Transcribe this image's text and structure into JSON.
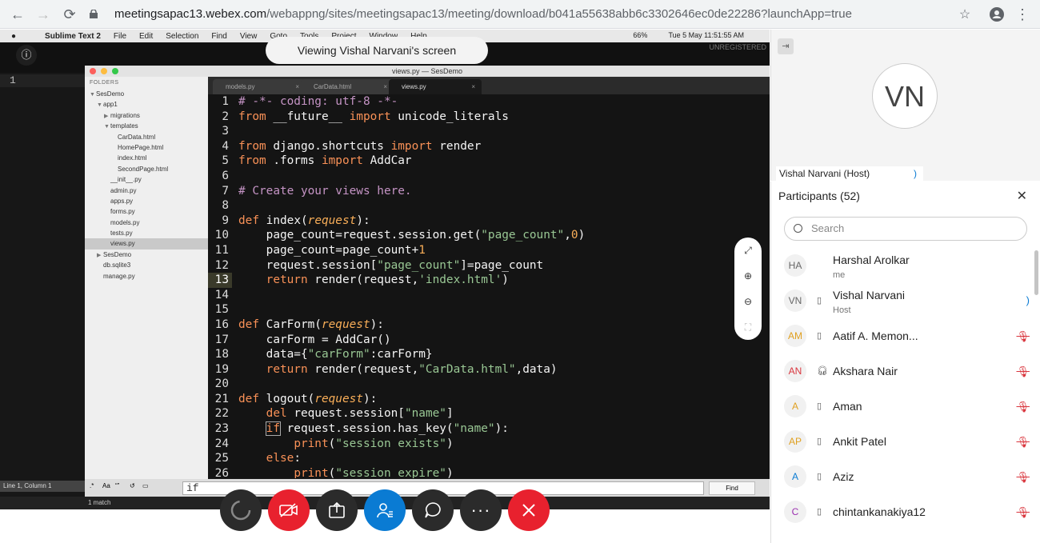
{
  "browser": {
    "url_host": "meetingsapac13.webex.com",
    "url_path": "/webappng/sites/meetingsapac13/meeting/download/b041a55638abb6c3302646ec0de22286?launchApp=true"
  },
  "mac_menubar": {
    "app": "Sublime Text 2",
    "menus": [
      "File",
      "Edit",
      "Selection",
      "Find",
      "View",
      "Goto",
      "Tools",
      "Project",
      "Window",
      "Help"
    ],
    "battery": "66%",
    "clock": "Tue 5 May  11:51:55 AM"
  },
  "viewing_banner": "Viewing Vishal Narvani's screen",
  "unregistered": "UNREGISTERED",
  "sublime": {
    "window_title": "views.py — SesDemo",
    "folders_header": "FOLDERS",
    "tree": [
      {
        "label": "SesDemo",
        "indent": 0,
        "arrow": "▼"
      },
      {
        "label": "app1",
        "indent": 1,
        "arrow": "▼"
      },
      {
        "label": "migrations",
        "indent": 2,
        "arrow": "▶"
      },
      {
        "label": "templates",
        "indent": 2,
        "arrow": "▼"
      },
      {
        "label": "CarData.html",
        "indent": 3,
        "arrow": ""
      },
      {
        "label": "HomePage.html",
        "indent": 3,
        "arrow": ""
      },
      {
        "label": "index.html",
        "indent": 3,
        "arrow": ""
      },
      {
        "label": "SecondPage.html",
        "indent": 3,
        "arrow": ""
      },
      {
        "label": "__init__.py",
        "indent": 2,
        "arrow": ""
      },
      {
        "label": "admin.py",
        "indent": 2,
        "arrow": ""
      },
      {
        "label": "apps.py",
        "indent": 2,
        "arrow": ""
      },
      {
        "label": "forms.py",
        "indent": 2,
        "arrow": ""
      },
      {
        "label": "models.py",
        "indent": 2,
        "arrow": ""
      },
      {
        "label": "tests.py",
        "indent": 2,
        "arrow": ""
      },
      {
        "label": "views.py",
        "indent": 2,
        "arrow": "",
        "selected": true
      },
      {
        "label": "SesDemo",
        "indent": 1,
        "arrow": "▶"
      },
      {
        "label": "db.sqlite3",
        "indent": 1,
        "arrow": ""
      },
      {
        "label": "manage.py",
        "indent": 1,
        "arrow": ""
      }
    ],
    "tabs": [
      "models.py",
      "CarData.html",
      "views.py"
    ],
    "active_tab": 2,
    "find_text": "if",
    "find_button": "Find",
    "status_left": "Line 1, Column 1",
    "status_match": "1 match",
    "bg_line_number": "1"
  },
  "controls": {
    "buttons": [
      "loading-spinner",
      "video-off",
      "share",
      "participants",
      "chat",
      "more",
      "end"
    ]
  },
  "video_panel": {
    "avatar_initials": "VN",
    "host_label": "Vishal Narvani (Host)"
  },
  "participants": {
    "title": "Participants (52)",
    "search_placeholder": "Search",
    "list": [
      {
        "initials": "HA",
        "name": "Harshal Arolkar",
        "sub": "me",
        "device": "",
        "muted": false,
        "speaking": false,
        "color": "#666666"
      },
      {
        "initials": "VN",
        "name": "Vishal Narvani",
        "sub": "Host",
        "device": "phone",
        "muted": false,
        "speaking": true,
        "color": "#666666"
      },
      {
        "initials": "AM",
        "name": "Aatif A. Memon...",
        "sub": "",
        "device": "phone",
        "muted": true,
        "speaking": false,
        "color": "#e0a020"
      },
      {
        "initials": "AN",
        "name": "Akshara Nair",
        "sub": "",
        "device": "headset",
        "muted": true,
        "speaking": false,
        "color": "#d9363e"
      },
      {
        "initials": "A",
        "name": "Aman",
        "sub": "",
        "device": "phone",
        "muted": true,
        "speaking": false,
        "color": "#e0a020"
      },
      {
        "initials": "AP",
        "name": "Ankit Patel",
        "sub": "",
        "device": "phone",
        "muted": true,
        "speaking": false,
        "color": "#e0a020"
      },
      {
        "initials": "A",
        "name": "Aziz",
        "sub": "",
        "device": "phone",
        "muted": true,
        "speaking": false,
        "color": "#0a7bd3"
      },
      {
        "initials": "C",
        "name": "chintankanakiya12",
        "sub": "",
        "device": "phone",
        "muted": true,
        "speaking": false,
        "color": "#9b30b0"
      }
    ]
  }
}
